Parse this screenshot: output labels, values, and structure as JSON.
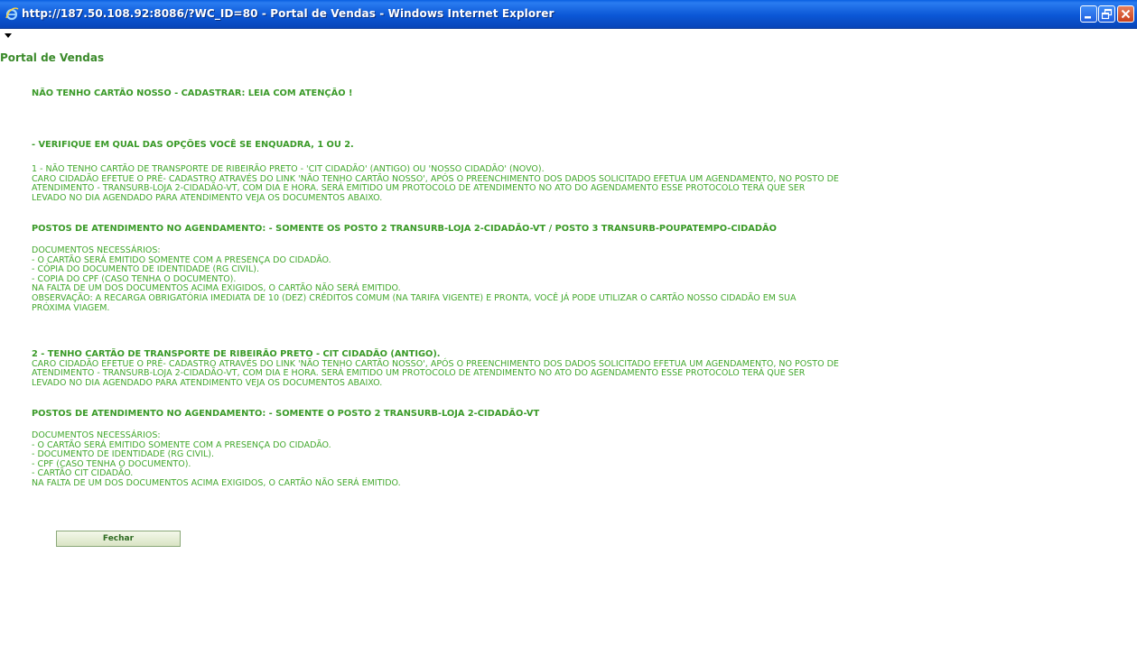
{
  "window": {
    "title": "http://187.50.108.92:8086/?WC_ID=80 - Portal de Vendas - Windows Internet Explorer"
  },
  "page": {
    "title": "Portal de Vendas",
    "heading": "NÃO TENHO CARTÃO NOSSO - CADASTRAR: LEIA COM ATENÇÃO !",
    "verify": "- VERIFIQUE EM QUAL DAS OPÇÕES VOCÊ SE ENQUADRA, 1 OU 2.",
    "option1": {
      "title": "1 - NÃO TENHO CARTÃO DE TRANSPORTE DE RIBEIRÃO PRETO - 'CIT CIDADÃO' (ANTIGO) OU 'NOSSO CIDADÃO' (NOVO).",
      "body": [
        "CARO CIDADÃO EFETUE O PRÉ- CADASTRO ATRAVÉS DO LINK 'NÃO TENHO CARTÃO NOSSO', APÓS O PREENCHIMENTO DOS DADOS SOLICITADO EFETUA UM AGENDAMENTO, NO POSTO DE",
        "ATENDIMENTO - TRANSURB-LOJA 2-CIDADÃO-VT, COM DIA E HORA. SERÁ EMITIDO UM PROTOCOLO DE ATENDIMENTO NO ATO DO AGENDAMENTO ESSE PROTOCOLO TERÁ QUE SER",
        "LEVADO NO DIA AGENDADO PARA ATENDIMENTO VEJA OS DOCUMENTOS ABAIXO."
      ],
      "postos": "POSTOS DE ATENDIMENTO NO AGENDAMENTO: - SOMENTE OS POSTO 2 TRANSURB-LOJA 2-CIDADÃO-VT / POSTO 3 TRANSURB-POUPATEMPO-CIDADÃO",
      "docs": [
        "DOCUMENTOS NECESSÁRIOS:",
        "- O CARTÃO SERÁ EMITIDO SOMENTE COM A PRESENÇA DO CIDADÃO.",
        "- CÓPIA DO DOCUMENTO DE IDENTIDADE (RG CIVIL).",
        "- COPIA DO CPF (CASO TENHA O DOCUMENTO).",
        "NA FALTA DE UM DOS DOCUMENTOS ACIMA EXIGIDOS, O CARTÃO NÃO SERÁ EMITIDO.",
        "OBSERVAÇÃO: A RECARGA OBRIGATÓRIA IMEDIATA DE 10 (DEZ) CRÉDITOS COMUM (NA TARIFA VIGENTE) E PRONTA, VOCÊ JÁ PODE UTILIZAR O CARTÃO NOSSO CIDADÃO EM SUA",
        "PRÓXIMA VIAGEM."
      ]
    },
    "option2": {
      "title": "2 - TENHO CARTÃO DE TRANSPORTE DE RIBEIRÃO PRETO - CIT CIDADÃO (ANTIGO).",
      "body": [
        "CARO CIDADÃO EFETUE O PRÉ- CADASTRO ATRAVÉS DO LINK 'NÃO TENHO CARTÃO NOSSO', APÓS O PREENCHIMENTO DOS DADOS SOLICITADO EFETUA UM AGENDAMENTO, NO POSTO DE",
        "ATENDIMENTO - TRANSURB-LOJA 2-CIDADÃO-VT, COM DIA E HORA. SERÁ EMITIDO UM PROTOCOLO DE ATENDIMENTO NO ATO DO AGENDAMENTO ESSE PROTOCOLO TERÁ QUE SER",
        "LEVADO NO DIA AGENDADO PARA ATENDIMENTO VEJA OS DOCUMENTOS ABAIXO."
      ],
      "postos": "POSTOS DE ATENDIMENTO NO AGENDAMENTO: - SOMENTE O POSTO 2 TRANSURB-LOJA 2-CIDADÃO-VT",
      "docs": [
        "DOCUMENTOS NECESSÁRIOS:",
        "- O CARTÃO SERÁ EMITIDO SOMENTE COM A PRESENÇA DO CIDADÃO.",
        "- DOCUMENTO DE IDENTIDADE (RG CIVIL).",
        "- CPF (CASO TENHA O DOCUMENTO).",
        "- CARTÃO CIT CIDADÃO.",
        "NA FALTA DE UM DOS DOCUMENTOS ACIMA EXIGIDOS, O CARTÃO NÃO SERÁ EMITIDO."
      ]
    },
    "close_button": "Fechar"
  },
  "colors": {
    "text_green": "#43a82e",
    "title_green": "#3a8a2a",
    "titlebar_blue": "#0b57d6"
  },
  "icons": [
    "ie-icon",
    "minimize-icon",
    "restore-icon",
    "close-icon",
    "collapse-arrow-icon"
  ]
}
